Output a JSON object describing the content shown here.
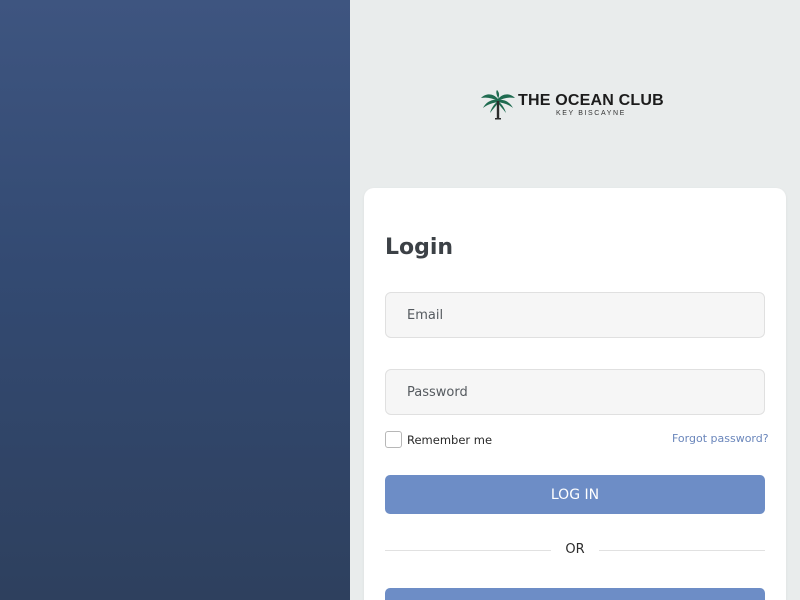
{
  "colors": {
    "left_panel_top": "#3e5580",
    "left_panel_bottom": "#2e405e",
    "background": "#e9ecec",
    "primary_button": "#6d8dc6",
    "link": "#6a86bb",
    "logo_palm": "#1f6b50"
  },
  "logo": {
    "icon": "palm-tree-icon",
    "name": "THE OCEAN CLUB",
    "subtitle": "KEY BISCAYNE"
  },
  "login": {
    "title": "Login",
    "email_placeholder": "Email",
    "password_placeholder": "Password",
    "remember_label": "Remember me",
    "remember_checked": false,
    "forgot_label": "Forgot password?",
    "login_button": "LOG IN",
    "divider": "OR"
  }
}
